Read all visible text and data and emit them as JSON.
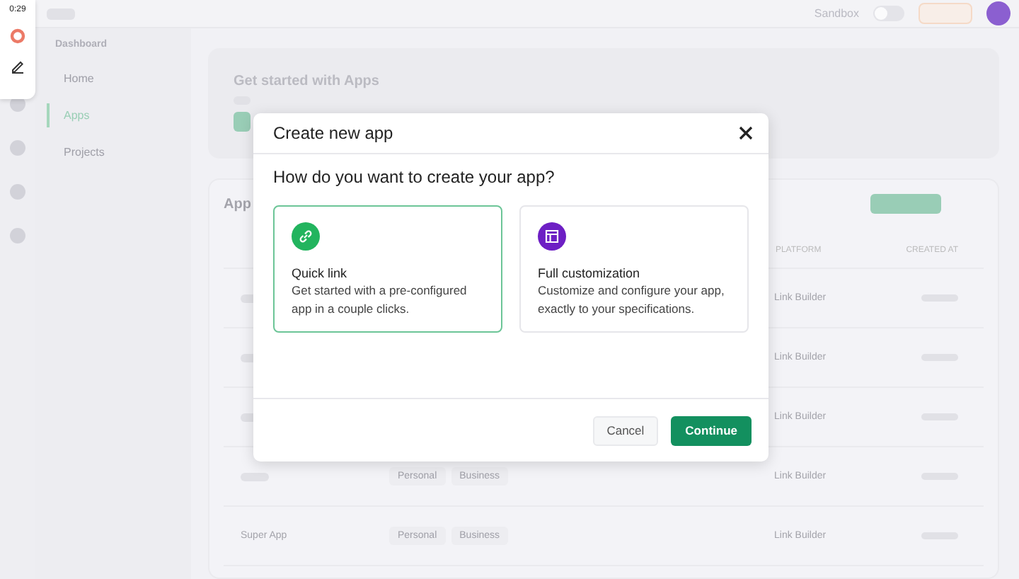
{
  "recorder": {
    "time": "0:29"
  },
  "topbar": {
    "sandbox_label": "Sandbox",
    "sandbox_on": false
  },
  "sidebar": {
    "heading": "Dashboard",
    "items": [
      {
        "label": "Home",
        "selected": false
      },
      {
        "label": "Apps",
        "selected": true
      },
      {
        "label": "Projects",
        "selected": false
      }
    ]
  },
  "banner": {
    "title": "Get started with Apps"
  },
  "apps_table": {
    "title": "App",
    "columns": [
      "PLATFORM",
      "CREATED AT"
    ],
    "rows": [
      {
        "tags": [],
        "platform": "Link Builder"
      },
      {
        "tags": [],
        "platform": "Link Builder"
      },
      {
        "tags": [],
        "platform": "Link Builder"
      },
      {
        "tags": [
          "Personal",
          "Business"
        ],
        "platform": "Link Builder"
      },
      {
        "name": "Super App",
        "tags": [
          "Personal",
          "Business"
        ],
        "platform": "Link Builder"
      }
    ]
  },
  "modal": {
    "title": "Create new app",
    "question": "How do you want to create your app?",
    "options": [
      {
        "kind": "link",
        "title": "Quick link",
        "description": "Get started with a pre-configured app in a couple clicks.",
        "selected": true
      },
      {
        "kind": "layout",
        "title": "Full customization",
        "description": "Customize and configure your app, exactly to your specifications.",
        "selected": false
      }
    ],
    "cancel": "Cancel",
    "continue": "Continue"
  }
}
